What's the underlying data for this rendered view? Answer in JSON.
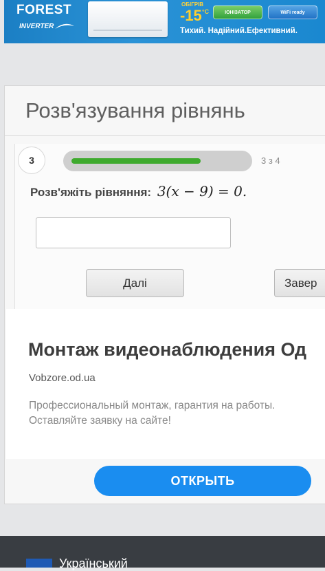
{
  "banner": {
    "brand": "FOREST",
    "brand_sub": "INVERTER",
    "temp_top": "ОБІГРІВ",
    "temp": "-15",
    "temp_unit": "°C",
    "badge_ion": "ІОНІЗАТОР",
    "badge_wifi": "WiFi ready",
    "slogan": "Тихий. Надійний.Ефективний."
  },
  "page": {
    "title": "Розв'язування рівнянь"
  },
  "quiz": {
    "step": "3",
    "progress_fraction": 0.75,
    "counter": "3 з 4",
    "question_label": "Розв'яжіть рівняння:",
    "equation": "3(x − 9) = 0.",
    "answer_value": "",
    "next_label": "Далі",
    "finish_label": "Завер"
  },
  "ad": {
    "title": "Монтаж видеонаблюдения Од",
    "domain": "Vobzore.od.ua",
    "desc_line1": "Профессиональный монтаж, гарантия на работы.",
    "desc_line2": "Оставляйте заявку на сайте!",
    "button": "ОТКРЫТЬ",
    "button_color": "#1a8df0"
  },
  "footer": {
    "text": "Український"
  },
  "colors": {
    "progress_fill": "#3faa2e",
    "banner_bg": "#1f88cf"
  }
}
